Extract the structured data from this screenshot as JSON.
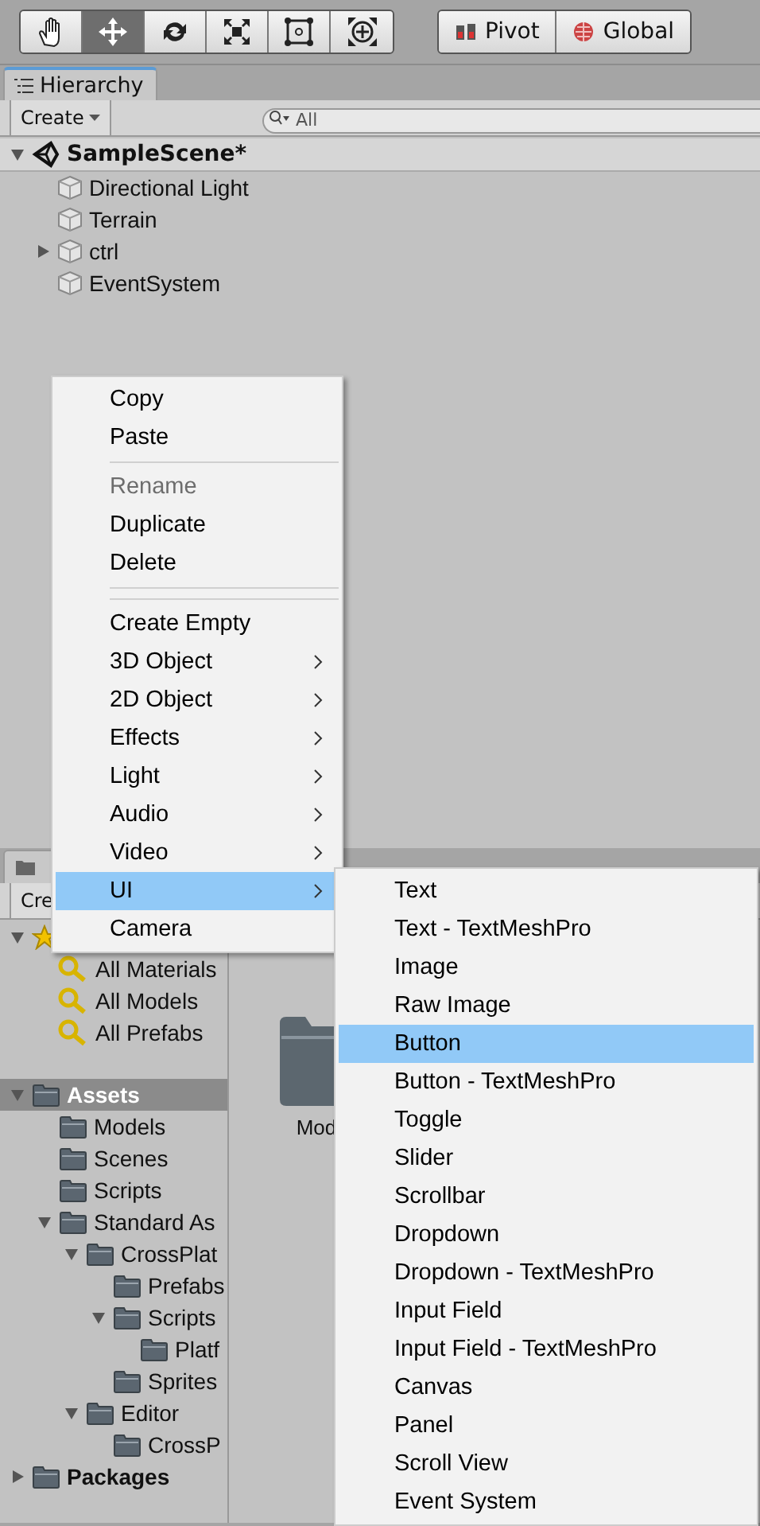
{
  "toolbar": {
    "tools": [
      {
        "kind": "hand",
        "selected": false
      },
      {
        "kind": "move",
        "selected": true
      },
      {
        "kind": "rotate",
        "selected": false
      },
      {
        "kind": "scale",
        "selected": false
      },
      {
        "kind": "rect",
        "selected": false
      },
      {
        "kind": "transform",
        "selected": false
      }
    ],
    "handle_buttons": [
      {
        "kind": "pivot",
        "label": "Pivot"
      },
      {
        "kind": "global",
        "label": "Global"
      }
    ]
  },
  "hierarchy": {
    "tab": "Hierarchy",
    "create": "Create",
    "search": {
      "placeholder": "All"
    },
    "scene": {
      "name": "SampleScene*",
      "expanded": true
    },
    "objects": [
      {
        "name": "Directional Light",
        "expandable": false
      },
      {
        "name": "Terrain",
        "expandable": false
      },
      {
        "name": "ctrl",
        "expandable": true
      },
      {
        "name": "EventSystem",
        "expandable": false
      }
    ]
  },
  "project": {
    "create": "Cre",
    "favorites": {
      "expanded": true,
      "items": [
        "All Materials",
        "All Models",
        "All Prefabs"
      ]
    },
    "tree": [
      {
        "name": "Assets",
        "selected": true,
        "expanded": true,
        "children": [
          {
            "name": "Models",
            "selected": false
          },
          {
            "name": "Scenes",
            "selected": false
          },
          {
            "name": "Scripts",
            "selected": false
          },
          {
            "name": "Standard As",
            "selected": false,
            "expanded": true,
            "children": [
              {
                "name": "CrossPlat",
                "selected": false,
                "expanded": true,
                "children": [
                  {
                    "name": "Prefabs",
                    "selected": false
                  },
                  {
                    "name": "Scripts",
                    "selected": false,
                    "expanded": true,
                    "children": [
                      {
                        "name": "Platf",
                        "selected": false
                      }
                    ]
                  },
                  {
                    "name": "Sprites",
                    "selected": false
                  }
                ]
              },
              {
                "name": "Editor",
                "selected": false,
                "expanded": true,
                "children": [
                  {
                    "name": "CrossP",
                    "selected": false
                  }
                ]
              }
            ]
          }
        ]
      },
      {
        "name": "Packages",
        "selected": false,
        "expanded": false
      }
    ],
    "grid": [
      {
        "label": "Mod"
      }
    ]
  },
  "context_menu": {
    "items": [
      {
        "kind": "item",
        "label": "Copy",
        "disabled": false,
        "submenu": false,
        "selected": false
      },
      {
        "kind": "item",
        "label": "Paste",
        "disabled": false,
        "submenu": false,
        "selected": false
      },
      {
        "kind": "separator"
      },
      {
        "kind": "item",
        "label": "Rename",
        "disabled": true,
        "submenu": false,
        "selected": false
      },
      {
        "kind": "item",
        "label": "Duplicate",
        "disabled": false,
        "submenu": false,
        "selected": false
      },
      {
        "kind": "item",
        "label": "Delete",
        "disabled": false,
        "submenu": false,
        "selected": false
      },
      {
        "kind": "separator"
      },
      {
        "kind": "separator"
      },
      {
        "kind": "item",
        "label": "Create Empty",
        "disabled": false,
        "submenu": false,
        "selected": false
      },
      {
        "kind": "item",
        "label": "3D Object",
        "disabled": false,
        "submenu": true,
        "selected": false
      },
      {
        "kind": "item",
        "label": "2D Object",
        "disabled": false,
        "submenu": true,
        "selected": false
      },
      {
        "kind": "item",
        "label": "Effects",
        "disabled": false,
        "submenu": true,
        "selected": false
      },
      {
        "kind": "item",
        "label": "Light",
        "disabled": false,
        "submenu": true,
        "selected": false
      },
      {
        "kind": "item",
        "label": "Audio",
        "disabled": false,
        "submenu": true,
        "selected": false
      },
      {
        "kind": "item",
        "label": "Video",
        "disabled": false,
        "submenu": true,
        "selected": false
      },
      {
        "kind": "item",
        "label": "UI",
        "disabled": false,
        "submenu": true,
        "selected": true
      },
      {
        "kind": "item",
        "label": "Camera",
        "disabled": false,
        "submenu": false,
        "selected": false
      }
    ]
  },
  "submenu": {
    "items": [
      {
        "label": "Text",
        "selected": false
      },
      {
        "label": "Text - TextMeshPro",
        "selected": false
      },
      {
        "label": "Image",
        "selected": false
      },
      {
        "label": "Raw Image",
        "selected": false
      },
      {
        "label": "Button",
        "selected": true
      },
      {
        "label": "Button - TextMeshPro",
        "selected": false
      },
      {
        "label": "Toggle",
        "selected": false
      },
      {
        "label": "Slider",
        "selected": false
      },
      {
        "label": "Scrollbar",
        "selected": false
      },
      {
        "label": "Dropdown",
        "selected": false
      },
      {
        "label": "Dropdown - TextMeshPro",
        "selected": false
      },
      {
        "label": "Input Field",
        "selected": false
      },
      {
        "label": "Input Field - TextMeshPro",
        "selected": false
      },
      {
        "label": "Canvas",
        "selected": false
      },
      {
        "label": "Panel",
        "selected": false
      },
      {
        "label": "Scroll View",
        "selected": false
      },
      {
        "label": "Event System",
        "selected": false
      }
    ]
  }
}
